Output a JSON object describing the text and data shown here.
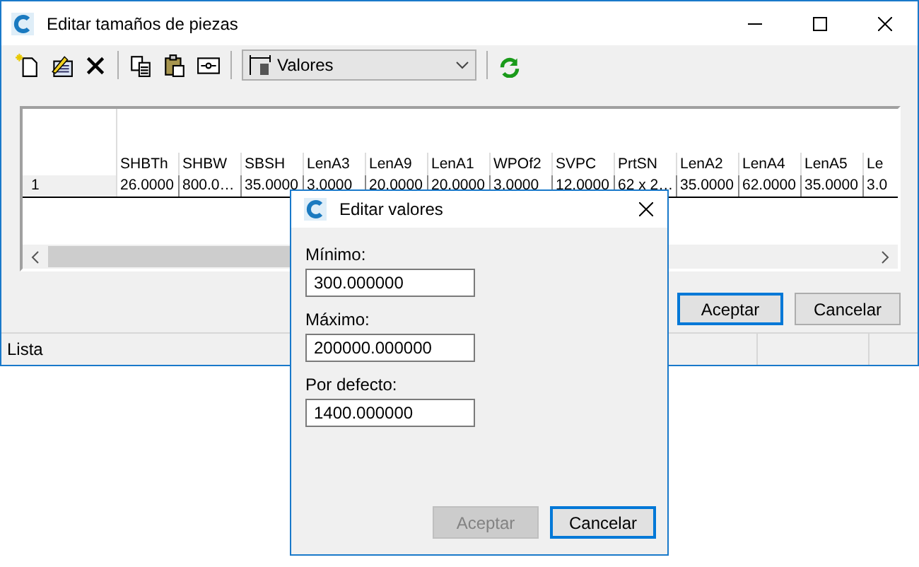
{
  "window": {
    "title": "Editar tamaños de piezas"
  },
  "toolbar": {
    "view_select": {
      "value": "Valores"
    }
  },
  "table": {
    "columns": [
      "SHBTh",
      "SHBW",
      "SBSH",
      "LenA3",
      "LenA9",
      "LenA1",
      "WPOf2",
      "SVPC",
      "PrtSN",
      "LenA2",
      "LenA4",
      "LenA5",
      "Le"
    ],
    "rows": [
      {
        "header": "1",
        "cells": [
          "26.0000",
          "800.0…",
          "35.0000",
          "3.0000",
          "20.0000",
          "20.0000",
          "3.0000",
          "12.0000",
          "62 x 2…",
          "35.0000",
          "62.0000",
          "35.0000",
          "3.0"
        ]
      }
    ]
  },
  "buttons": [
    {
      "label": "Aceptar",
      "default": true
    },
    {
      "label": "Cancelar",
      "default": false
    }
  ],
  "status_bar": {
    "text": "Lista"
  },
  "dialog": {
    "title": "Editar valores",
    "fields": [
      {
        "label": "Mínimo:",
        "value": "300.000000"
      },
      {
        "label": "Máximo:",
        "value": "200000.000000"
      },
      {
        "label": "Por defecto:",
        "value": "1400.000000"
      }
    ],
    "buttons": [
      {
        "label": "Aceptar",
        "disabled": true,
        "default": false
      },
      {
        "label": "Cancelar",
        "disabled": false,
        "default": true
      }
    ]
  }
}
